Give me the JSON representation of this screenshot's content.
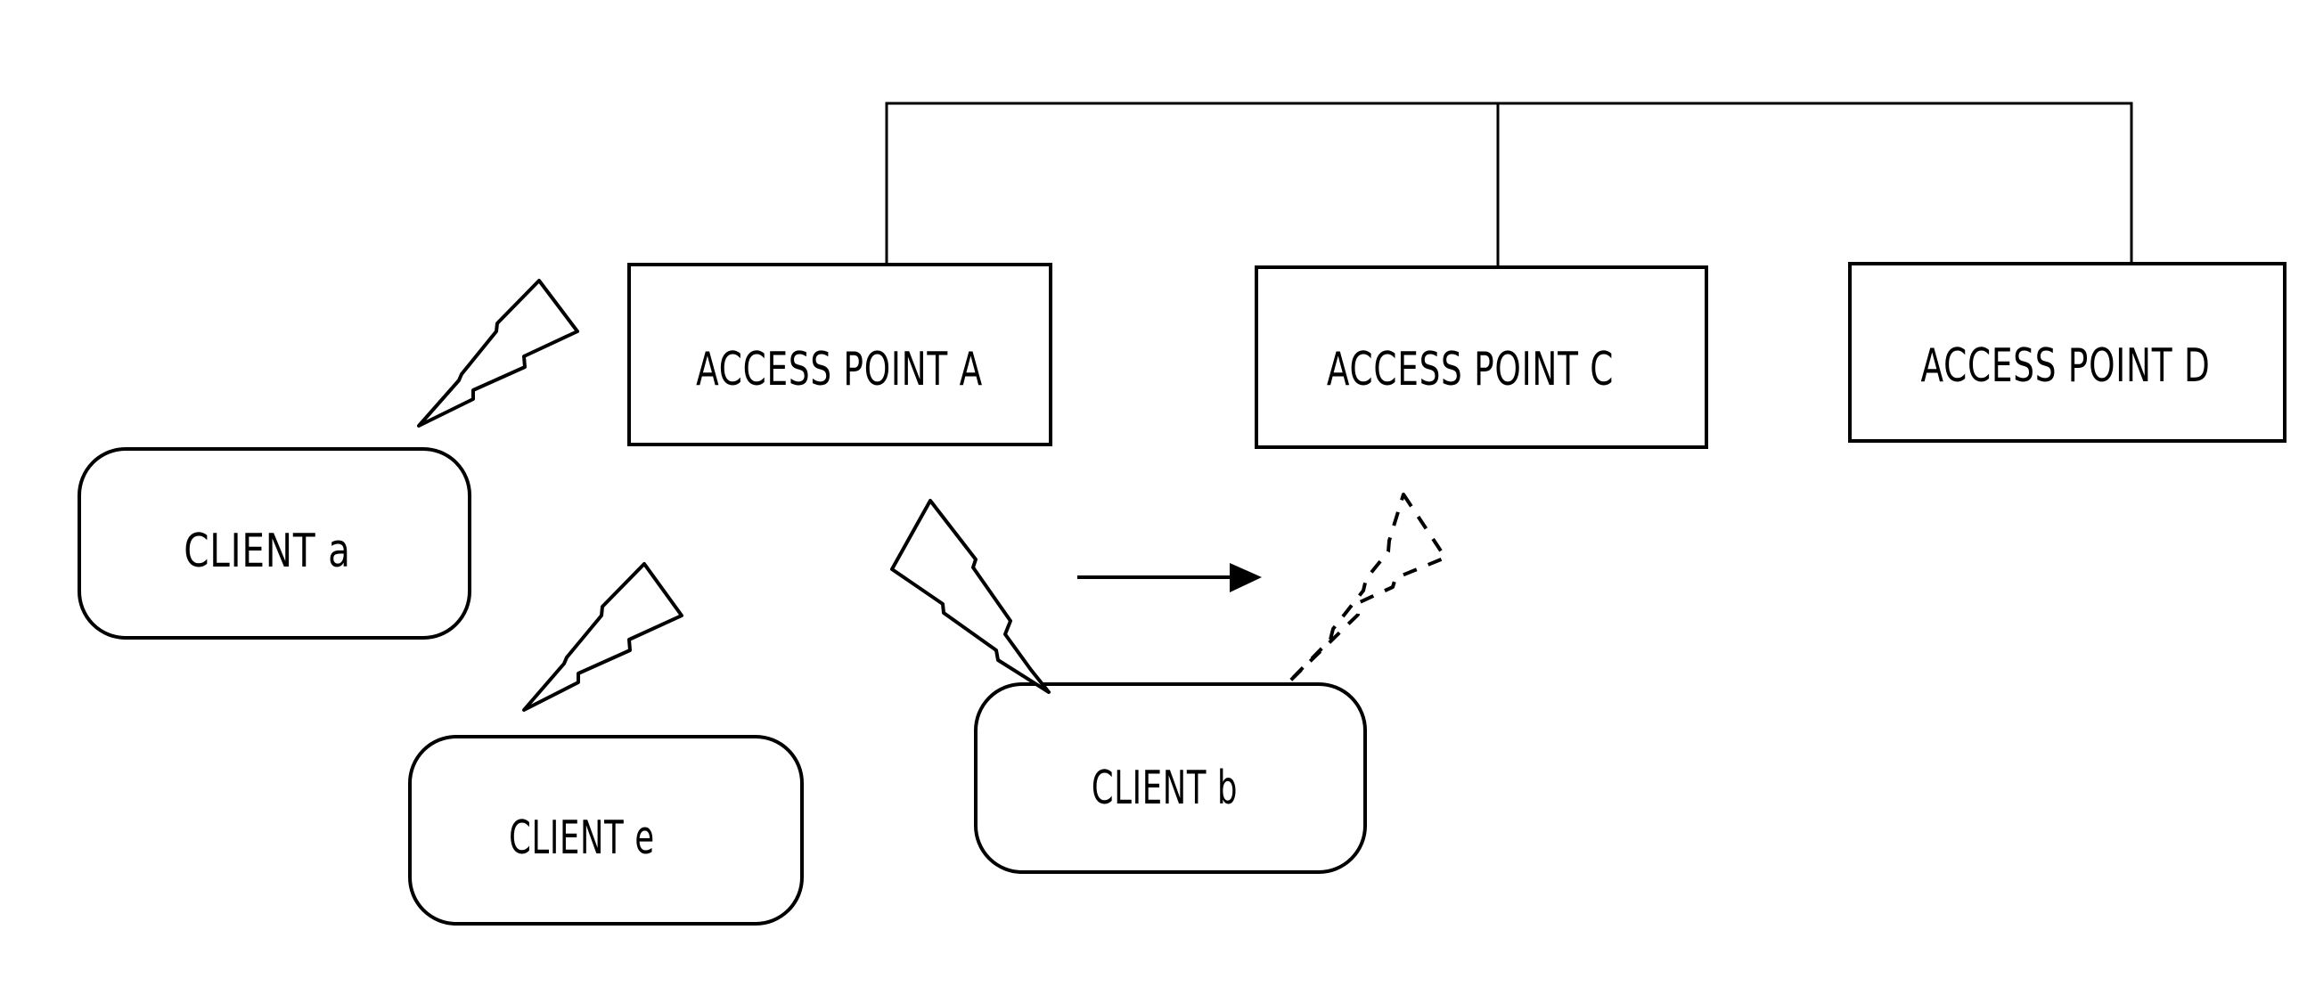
{
  "diagram": {
    "type": "network-topology",
    "access_points": [
      {
        "id": "A",
        "label": "ACCESS POINT A"
      },
      {
        "id": "C",
        "label": "ACCESS POINT C"
      },
      {
        "id": "D",
        "label": "ACCESS POINT D"
      }
    ],
    "clients": [
      {
        "id": "a",
        "label": "CLIENT a"
      },
      {
        "id": "e",
        "label": "CLIENT e"
      },
      {
        "id": "b",
        "label": "CLIENT b"
      }
    ],
    "wired_backbone": [
      "A",
      "C",
      "D"
    ],
    "wireless_links": [
      {
        "from": "a",
        "to": "A",
        "style": "solid"
      },
      {
        "from": "e",
        "to": "A",
        "style": "solid"
      },
      {
        "from": "b",
        "to": "A",
        "style": "solid"
      },
      {
        "from": "b",
        "to": "C",
        "style": "dashed",
        "note": "handover target"
      }
    ],
    "transition_arrow": {
      "from": "link-b-A",
      "to": "link-b-C"
    },
    "colors": {
      "stroke": "#000000",
      "background": "#ffffff"
    }
  }
}
